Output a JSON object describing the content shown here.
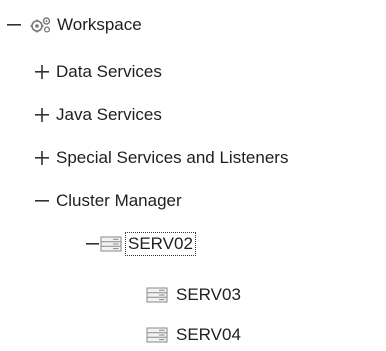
{
  "tree": {
    "root": {
      "label": "Workspace",
      "expanded": true,
      "icon": "gears-icon"
    },
    "children": [
      {
        "label": "Data Services",
        "expanded": false
      },
      {
        "label": "Java Services",
        "expanded": false
      },
      {
        "label": "Special Services and Listeners",
        "expanded": false
      },
      {
        "label": "Cluster Manager",
        "expanded": true,
        "children": [
          {
            "label": "SERV02",
            "expanded": true,
            "selected": true,
            "icon": "server-icon",
            "children": [
              {
                "label": "SERV03",
                "icon": "server-icon"
              },
              {
                "label": "SERV04",
                "icon": "server-icon"
              }
            ]
          }
        ]
      }
    ]
  }
}
